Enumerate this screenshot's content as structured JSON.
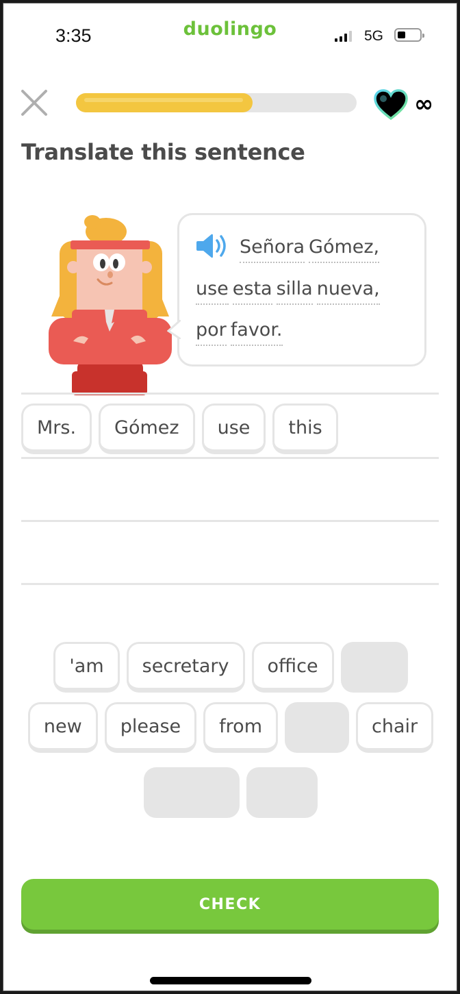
{
  "status_bar": {
    "time": "3:35",
    "app_brand": "duolingo",
    "network": "5G",
    "signal_icon": "cellular-signal-icon",
    "battery_icon": "battery-icon"
  },
  "top_bar": {
    "close_icon": "close-icon",
    "progress_fraction": 0.63,
    "hearts_icon": "heart-icon",
    "hearts_value": "∞"
  },
  "exercise": {
    "title": "Translate this sentence",
    "audio_icon": "speaker-icon",
    "prompt_lines": [
      [
        "Señora",
        "Gómez,"
      ],
      [
        "use",
        "esta",
        "silla",
        "nueva,"
      ],
      [
        "por",
        "favor."
      ]
    ]
  },
  "answer": {
    "selected_words": [
      "Mrs.",
      "Gómez",
      "use",
      "this"
    ]
  },
  "word_bank": {
    "rows": [
      [
        {
          "label": "'am",
          "used": false
        },
        {
          "label": "secretary",
          "used": false
        },
        {
          "label": "office",
          "used": false
        },
        {
          "label": "",
          "used": true
        }
      ],
      [
        {
          "label": "new",
          "used": false
        },
        {
          "label": "please",
          "used": false
        },
        {
          "label": "from",
          "used": false
        },
        {
          "label": "",
          "used": true
        },
        {
          "label": "chair",
          "used": false
        }
      ],
      [
        {
          "label": "",
          "used": true
        },
        {
          "label": "",
          "used": true
        }
      ]
    ]
  },
  "footer": {
    "check_label": "CHECK"
  },
  "colors": {
    "brand_green": "#78c83d",
    "progress_yellow": "#f3c640",
    "speaker_blue": "#4ea8ec",
    "text_gray": "#4b4b4b"
  }
}
